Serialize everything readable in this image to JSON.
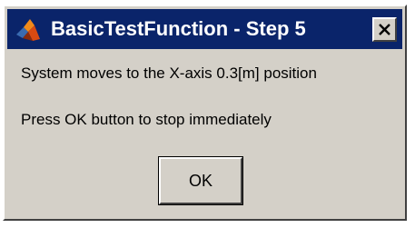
{
  "window": {
    "title": "BasicTestFunction - Step 5",
    "icon": "matlab-logo-icon",
    "close_glyph": "close-icon"
  },
  "message": {
    "line1": "System moves to the X-axis 0.3[m] position",
    "line2": "Press OK button to stop immediately"
  },
  "buttons": {
    "ok_label": "OK"
  },
  "colors": {
    "titlebar": "#0a246a",
    "dialog_face": "#d4d0c8",
    "title_text": "#ffffff"
  }
}
